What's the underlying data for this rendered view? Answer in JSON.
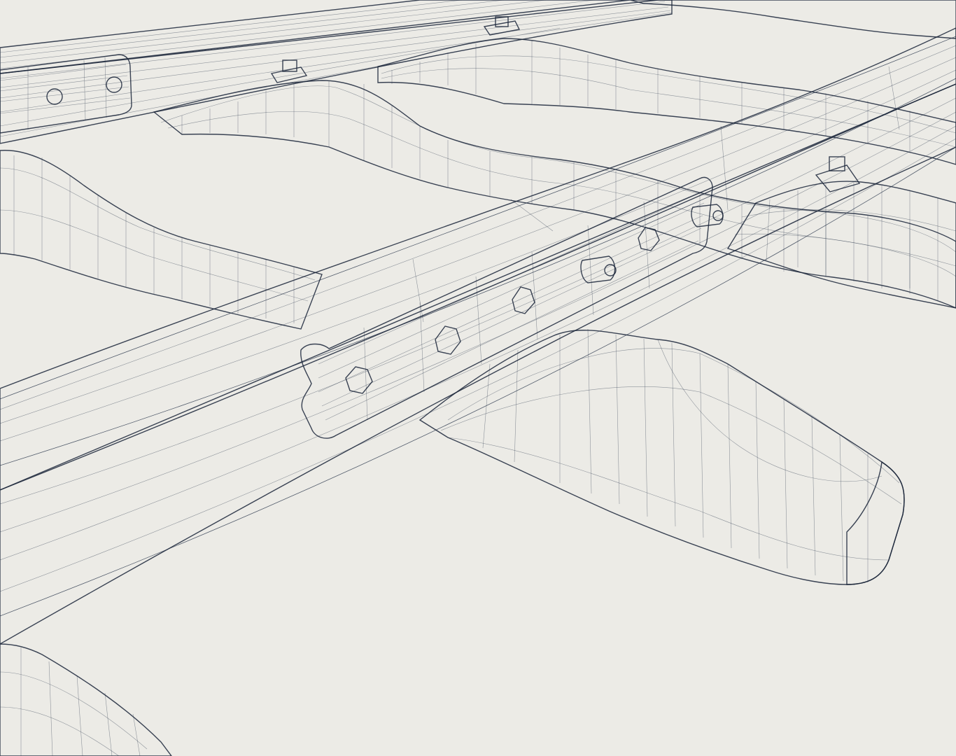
{
  "scene": {
    "background_color": "#ecebe6",
    "mesh_color": "#a9cdf2",
    "mesh_highlight": "#d9ecfb",
    "mesh_shadow": "#7ea6d6",
    "wire_color": "#1c2a40"
  }
}
